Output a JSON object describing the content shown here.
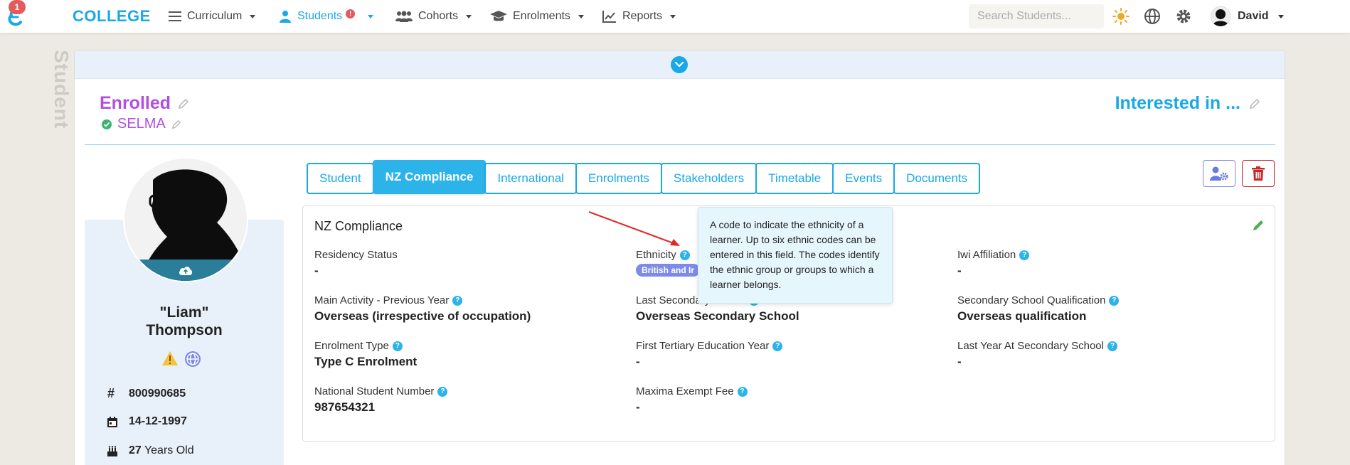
{
  "nav": {
    "logo_badge": "1",
    "brand": "COLLEGE",
    "items": [
      {
        "label": "Curriculum",
        "icon": "hamburger-icon"
      },
      {
        "label": "Students",
        "icon": "person-icon",
        "badge": "!"
      },
      {
        "label": "Cohorts",
        "icon": "users-icon"
      },
      {
        "label": "Enrolments",
        "icon": "graduation-cap-icon"
      },
      {
        "label": "Reports",
        "icon": "line-chart-icon"
      }
    ],
    "search_placeholder": "Search Students...",
    "user_name": "David"
  },
  "side_label": "Student",
  "header": {
    "status": "Enrolled",
    "sub_status": "SELMA",
    "interested": "Interested in ..."
  },
  "profile": {
    "name_line1": "\"Liam\"",
    "name_line2": "Thompson",
    "student_id": "800990685",
    "dob": "14-12-1997",
    "age_number": "27",
    "age_suffix": "Years Old"
  },
  "tabs": [
    {
      "label": "Student"
    },
    {
      "label": "NZ Compliance",
      "active": true
    },
    {
      "label": "International"
    },
    {
      "label": "Enrolments"
    },
    {
      "label": "Stakeholders"
    },
    {
      "label": "Timetable"
    },
    {
      "label": "Events"
    },
    {
      "label": "Documents"
    }
  ],
  "section": {
    "title": "NZ Compliance",
    "fields": {
      "residency_status": {
        "label": "Residency Status",
        "value": "-"
      },
      "ethnicity": {
        "label": "Ethnicity",
        "value": "British and Ir"
      },
      "iwi_affiliation": {
        "label": "Iwi Affiliation",
        "value": "-"
      },
      "main_activity": {
        "label": "Main Activity - Previous Year",
        "value": "Overseas (irrespective of occupation)"
      },
      "last_secondary_school": {
        "label": "Last Secondary School",
        "value": "Overseas Secondary School"
      },
      "secondary_qualification": {
        "label": "Secondary School Qualification",
        "value": "Overseas qualification"
      },
      "enrolment_type": {
        "label": "Enrolment Type",
        "value": "Type C Enrolment"
      },
      "first_tertiary_year": {
        "label": "First Tertiary Education Year",
        "value": "-"
      },
      "last_year_secondary": {
        "label": "Last Year At Secondary School",
        "value": "-"
      },
      "nsn": {
        "label": "National Student Number",
        "value": "987654321"
      },
      "maxima_exempt_fee": {
        "label": "Maxima Exempt Fee",
        "value": "-"
      }
    }
  },
  "tooltip": "A code to indicate the ethnicity of a learner. Up to six ethnic codes can be entered in this field. The codes identify the ethnic group or groups to which a learner belongs.",
  "colors": {
    "brand": "#1aa8e6",
    "status": "#b34ee0",
    "tab_active": "#2cb3ea",
    "delete": "#c62828",
    "pill": "#7c8be8",
    "arrow": "#e02a2a"
  }
}
